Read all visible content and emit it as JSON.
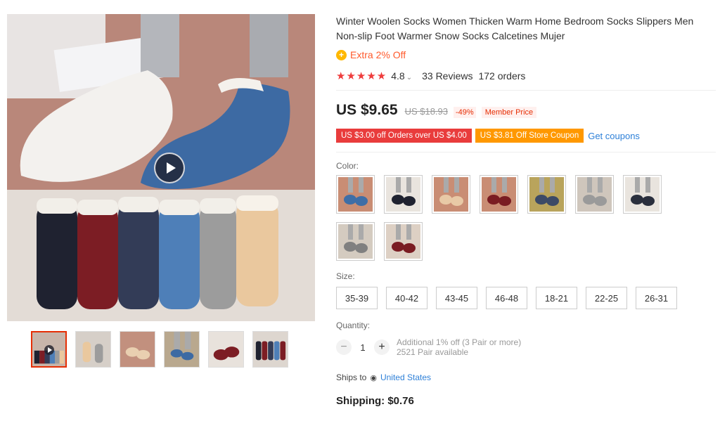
{
  "product": {
    "title": "Winter Woolen Socks Women Thicken Warm Home Bedroom Socks Slippers Men Non-slip Foot Warmer Snow Socks Calcetines Mujer",
    "extra_off": "Extra 2% Off",
    "extra_icon": "coin-icon",
    "rating": {
      "stars": "★★★★★",
      "value": "4.8",
      "reviews": "33 Reviews",
      "orders": "172 orders"
    },
    "price": {
      "current": "US $9.65",
      "original": "US $18.93",
      "discount": "-49%",
      "member_label": "Member Price"
    },
    "coupons": {
      "order_coupon": "US $3.00 off Orders over US $4.00",
      "store_coupon": "US $3.81 Off Store Coupon",
      "get_link": "Get coupons"
    },
    "color": {
      "label": "Color:",
      "options": [
        {
          "sock": "#3f6ea6",
          "floor": "#c98d74"
        },
        {
          "sock": "#1f2230",
          "floor": "#e9e4de"
        },
        {
          "sock": "#e8c9a6",
          "floor": "#c98d74"
        },
        {
          "sock": "#7a1c22",
          "floor": "#c98d74"
        },
        {
          "sock": "#3c4a66",
          "floor": "#b9a45c"
        },
        {
          "sock": "#9a9a9a",
          "floor": "#cfc6bc"
        },
        {
          "sock": "#2a2f3d",
          "floor": "#e9e4de"
        },
        {
          "sock": "#808080",
          "floor": "#d4cbc0"
        },
        {
          "sock": "#7a1c22",
          "floor": "#ddd0c4"
        }
      ]
    },
    "size": {
      "label": "Size:",
      "options": [
        "35-39",
        "40-42",
        "43-45",
        "46-48",
        "18-21",
        "22-25",
        "26-31"
      ]
    },
    "quantity": {
      "label": "Quantity:",
      "minus": "−",
      "value": "1",
      "plus": "+",
      "bulk_note": "Additional 1% off (3 Pair or more)",
      "available": "2521 Pair available"
    },
    "shipping": {
      "ships_to_label": "Ships to",
      "country": "United States",
      "pin_icon": "location-pin-icon",
      "cost": "Shipping: $0.76"
    }
  },
  "colors": {
    "accent_red": "#e62e04",
    "star_red": "#ef3c3c",
    "link_blue": "#2e80d8",
    "coupon_orange": "#ff9800",
    "coupon_red": "#e93c3c"
  }
}
